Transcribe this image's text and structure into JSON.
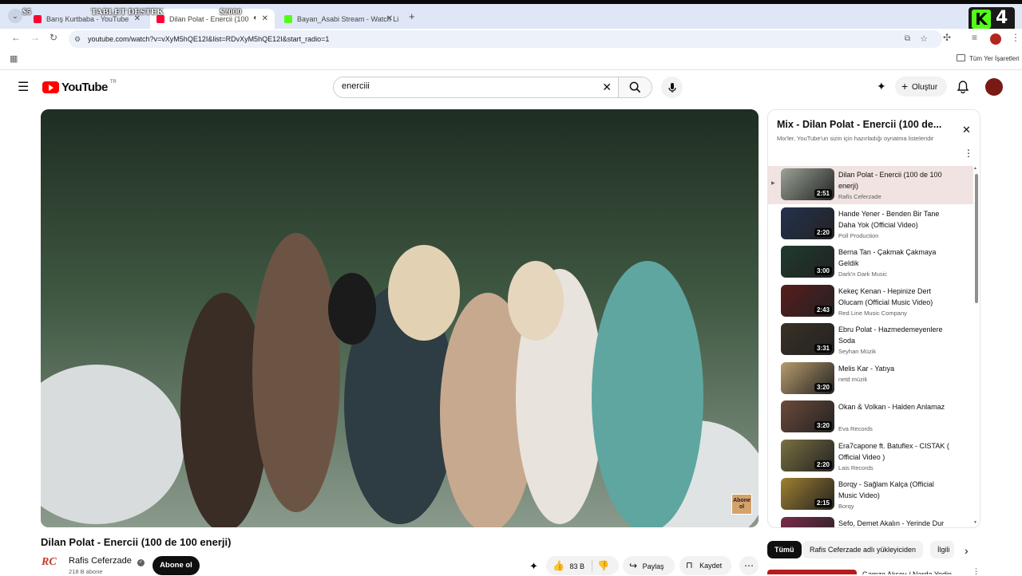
{
  "overlay": {
    "left_amount": "$5",
    "banner": "TABLET DESTEK",
    "right_amount": "$2000",
    "counter": "4"
  },
  "browser": {
    "tabs": [
      {
        "title": "Barış Kurtbaba - YouTube"
      },
      {
        "title": "Dilan Polat - Enercii (100 de"
      },
      {
        "title": "Bayan_Asabi Stream - Watch Li"
      }
    ],
    "new_tab": "+",
    "url": "youtube.com/watch?v=vXyM5hQE12I&list=RDvXyM5hQE12I&start_radio=1",
    "bookmarks_label": "Tüm Yer İşaretleri"
  },
  "yt": {
    "logo": "YouTube",
    "region": "TR",
    "search_value": "enerciii",
    "create_label": "Oluştur"
  },
  "video": {
    "title": "Dilan Polat - Enercii (100 de 100 enerji)",
    "watermark": "Abone ol"
  },
  "channel": {
    "name": "Rafis Ceferzade",
    "subs": "218 B abone",
    "subscribe": "Abone ol",
    "logo": "RC"
  },
  "actions": {
    "likes": "83 B",
    "share": "Paylaş",
    "save": "Kaydet"
  },
  "playlist": {
    "title": "Mix - Dilan Polat - Enercii (100 de...",
    "subtitle": "Mix'ler, YouTube'un sizin için hazırladığı oynatma listeleridir",
    "items": [
      {
        "title": "Dilan Polat - Enercii (100 de 100 enerji)",
        "channel": "Rafis Ceferzade",
        "duration": "2:51",
        "color": "#9aa396"
      },
      {
        "title": "Hande Yener - Benden Bir Tane Daha Yok (Official Video)",
        "channel": "Poll Production",
        "duration": "2:20",
        "color": "#24324e"
      },
      {
        "title": "Berna Tan - Çakmak Çakmaya Geldik",
        "channel": "Dark'n Dark Music",
        "duration": "3:00",
        "color": "#1f3b2e"
      },
      {
        "title": "Kekeç Kenan - Hepinize Dert Olucam (Official Music Video)",
        "channel": "Red Line Music Company",
        "duration": "2:43",
        "color": "#5a1c1c"
      },
      {
        "title": "Ebru Polat - Hazmedemeyenlere Soda",
        "channel": "Seyhan Müzik",
        "duration": "3:31",
        "color": "#3b3025"
      },
      {
        "title": "Melis Kar - Yatıya",
        "channel": "netd müzik",
        "duration": "3:20",
        "color": "#b89c6c"
      },
      {
        "title": "Okan & Volkan - Halden Anlamaz",
        "channel": "Eva Records",
        "duration": "3:20",
        "color": "#6b4a3a"
      },
      {
        "title": "Era7capone ft. Batuflex - CISTAK ( Official Video )",
        "channel": "Lais Records",
        "duration": "2:20",
        "color": "#7a7040"
      },
      {
        "title": "Borqy - Sağlam Kalça (Official Music Video)",
        "channel": "Borqy",
        "duration": "2:15",
        "color": "#a08030"
      },
      {
        "title": "Sefo, Demet Akalın - Yerinde Dur (Official Video)",
        "channel": "",
        "duration": "",
        "color": "#7a2a4a"
      }
    ]
  },
  "chips": [
    "Tümü",
    "Rafis Ceferzade adlı yükleyiciden",
    "İlgili"
  ],
  "next_video_title": "Gamze Aksoy / Narda Yedin"
}
